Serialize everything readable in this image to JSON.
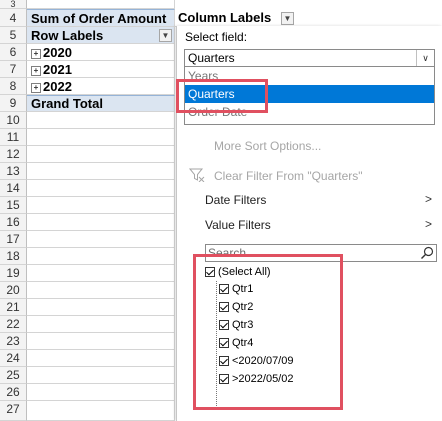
{
  "sheet": {
    "row_numbers": [
      "3",
      "4",
      "5",
      "6",
      "7",
      "8",
      "9",
      "10",
      "11",
      "12",
      "13",
      "14",
      "15",
      "16",
      "17",
      "18",
      "19",
      "20",
      "21",
      "22",
      "23",
      "24",
      "25",
      "26",
      "27"
    ],
    "a4": "Sum of Order Amount",
    "b4": "Column Labels",
    "a5": "Row Labels",
    "rows": [
      "2020",
      "2021",
      "2022"
    ],
    "grand_total": "Grand Total"
  },
  "filter_panel": {
    "select_field_label": "Select field:",
    "selected_field": "Quarters",
    "field_options": [
      "Years",
      "Quarters",
      "Order Date"
    ],
    "more_sort_options": "More Sort Options...",
    "clear_filter": "Clear Filter From \"Quarters\"",
    "date_filters": "Date Filters",
    "value_filters": "Value Filters",
    "search_placeholder": "Search",
    "items": [
      {
        "label": "(Select All)",
        "checked": true
      },
      {
        "label": "Qtr1",
        "checked": true
      },
      {
        "label": "Qtr2",
        "checked": true
      },
      {
        "label": "Qtr3",
        "checked": true
      },
      {
        "label": "Qtr4",
        "checked": true
      },
      {
        "label": "<2020/07/09",
        "checked": true
      },
      {
        "label": ">2022/05/02",
        "checked": true
      }
    ]
  },
  "colors": {
    "selection_blue": "#0078d7",
    "highlight_red": "#e05060",
    "pivot_header": "#dbe5f1"
  }
}
